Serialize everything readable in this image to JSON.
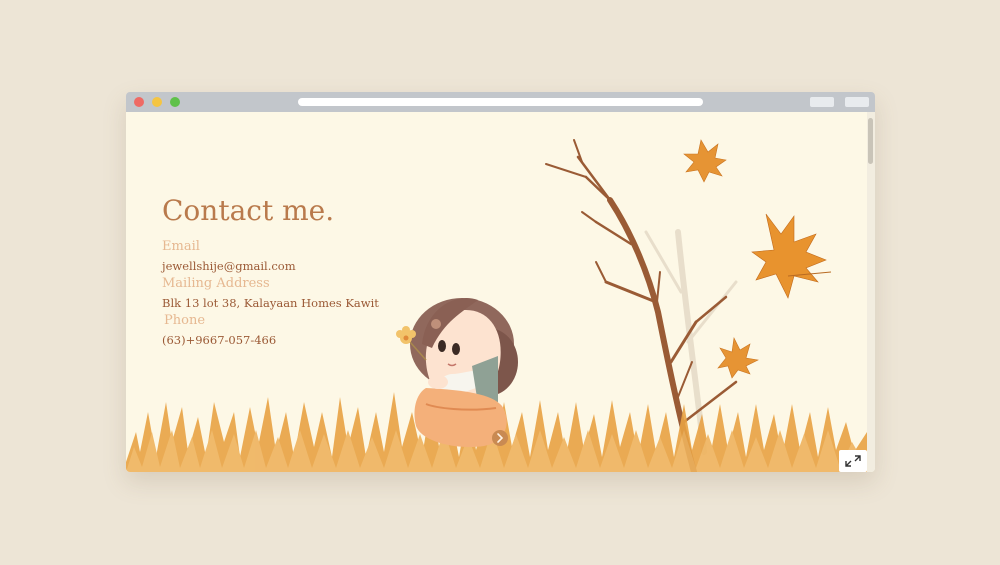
{
  "colors": {
    "backdrop": "#ede5d6",
    "titlebar": "#c2c6cb",
    "page_background": "#fdf8e6",
    "heading": "#b97a4c",
    "label": "#e6b891",
    "value": "#9b5a36",
    "dot_close": "#ef6a64",
    "dot_minimize": "#f5c542",
    "dot_maximize": "#5fc14a",
    "grass": "#e8a244",
    "leaf": "#e69434"
  },
  "contact": {
    "heading": "Contact me.",
    "email_label": "Email",
    "email_value": "jewellshije@gmail.com",
    "address_label": "Mailing Address",
    "address_value": "Blk 13 lot 38, Kalayaan Homes Kawit",
    "phone_label": "Phone",
    "phone_value": "(63)+9667-057-466"
  },
  "icons": {
    "expand": "expand-icon",
    "next": "chevron-right-icon"
  }
}
